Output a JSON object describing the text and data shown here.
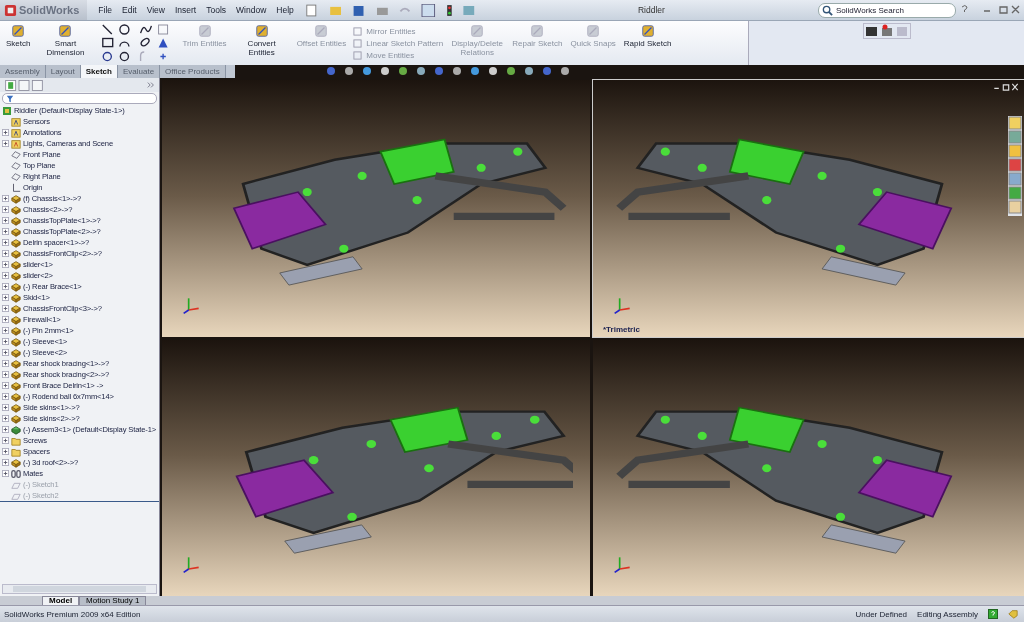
{
  "window": {
    "logo": "SolidWorks",
    "title": "Riddler"
  },
  "menu": [
    "File",
    "Edit",
    "View",
    "Insert",
    "Tools",
    "Window",
    "Help"
  ],
  "search": {
    "placeholder": "SolidWorks Search"
  },
  "commands": [
    {
      "kind": "large",
      "label": "Sketch",
      "disabled": false
    },
    {
      "kind": "large",
      "label": "Smart Dimension",
      "disabled": false
    },
    {
      "kind": "tools"
    },
    {
      "kind": "large",
      "label": "Trim Entities",
      "disabled": true
    },
    {
      "kind": "large",
      "label": "Convert Entities",
      "disabled": false
    },
    {
      "kind": "large",
      "label": "Offset Entities",
      "disabled": true
    },
    {
      "kind": "list",
      "items": [
        {
          "label": "Mirror Entities",
          "disabled": true
        },
        {
          "label": "Linear Sketch Pattern",
          "disabled": true
        },
        {
          "label": "Move Entities",
          "disabled": true
        }
      ]
    },
    {
      "kind": "large",
      "label": "Display/Delete Relations",
      "disabled": true
    },
    {
      "kind": "large",
      "label": "Repair Sketch",
      "disabled": true
    },
    {
      "kind": "large",
      "label": "Quick Snaps",
      "disabled": true
    },
    {
      "kind": "large",
      "label": "Rapid Sketch",
      "disabled": false
    }
  ],
  "tabs": [
    {
      "label": "Assembly",
      "selected": false
    },
    {
      "label": "Layout",
      "selected": false
    },
    {
      "label": "Sketch",
      "selected": true
    },
    {
      "label": "Evaluate",
      "selected": false
    },
    {
      "label": "Office Products",
      "selected": false
    }
  ],
  "tree": {
    "label": "Riddler  (Default<Display State-1>)",
    "children": [
      {
        "kind": "sensor",
        "label": "Sensors",
        "collapsed": false,
        "disabled": false
      },
      {
        "kind": "annotation",
        "label": "Annotations",
        "collapsed": true,
        "disabled": false
      },
      {
        "kind": "lights",
        "label": "Lights, Cameras and Scene",
        "collapsed": true,
        "disabled": false
      },
      {
        "kind": "plane",
        "label": "Front Plane",
        "collapsed": false,
        "disabled": false
      },
      {
        "kind": "plane",
        "label": "Top Plane",
        "collapsed": false,
        "disabled": false
      },
      {
        "kind": "plane",
        "label": "Right Plane",
        "collapsed": false,
        "disabled": false
      },
      {
        "kind": "origin",
        "label": "Origin",
        "collapsed": false,
        "disabled": false
      },
      {
        "kind": "part",
        "label": "(f) Chassis<1>->?",
        "collapsed": true,
        "disabled": false
      },
      {
        "kind": "part",
        "label": "Chassis<2>->?",
        "collapsed": true,
        "disabled": false
      },
      {
        "kind": "part",
        "label": "ChassisTopPlate<1>->?",
        "collapsed": true,
        "disabled": false
      },
      {
        "kind": "part",
        "label": "ChassisTopPlate<2>->?",
        "collapsed": true,
        "disabled": false
      },
      {
        "kind": "part",
        "label": "Delrin spacer<1>->?",
        "collapsed": true,
        "disabled": false
      },
      {
        "kind": "part",
        "label": "ChassisFrontClip<2>->?",
        "collapsed": true,
        "disabled": false
      },
      {
        "kind": "part",
        "label": "slider<1>",
        "collapsed": true,
        "disabled": false
      },
      {
        "kind": "part",
        "label": "slider<2>",
        "collapsed": true,
        "disabled": false
      },
      {
        "kind": "part",
        "label": "(-) Rear Brace<1>",
        "collapsed": true,
        "disabled": false
      },
      {
        "kind": "part",
        "label": "Skid<1>",
        "collapsed": true,
        "disabled": false
      },
      {
        "kind": "part",
        "label": "ChassisFrontClip<3>->?",
        "collapsed": true,
        "disabled": false
      },
      {
        "kind": "part",
        "label": "Firewall<1>",
        "collapsed": true,
        "disabled": false
      },
      {
        "kind": "part",
        "label": "(-) Pin 2mm<1>",
        "collapsed": true,
        "disabled": false
      },
      {
        "kind": "part",
        "label": "(-) Sleeve<1>",
        "collapsed": true,
        "disabled": false
      },
      {
        "kind": "part",
        "label": "(-) Sleeve<2>",
        "collapsed": true,
        "disabled": false
      },
      {
        "kind": "part",
        "label": "Rear shock bracing<1>->?",
        "collapsed": true,
        "disabled": false
      },
      {
        "kind": "part",
        "label": "Rear shock bracing<2>->?",
        "collapsed": true,
        "disabled": false
      },
      {
        "kind": "part",
        "label": "Front Brace Delrin<1> ->",
        "collapsed": true,
        "disabled": false
      },
      {
        "kind": "part",
        "label": "(-) Rodend ball 6x7mm<14>",
        "collapsed": true,
        "disabled": false
      },
      {
        "kind": "part",
        "label": "Side skins<1>->?",
        "collapsed": true,
        "disabled": false
      },
      {
        "kind": "part",
        "label": "Side skins<2>->?",
        "collapsed": true,
        "disabled": false
      },
      {
        "kind": "assembly",
        "label": "(-) Assem3<1> (Default<Display State-1>",
        "collapsed": true,
        "disabled": false
      },
      {
        "kind": "folder",
        "label": "Screws",
        "collapsed": true,
        "disabled": false
      },
      {
        "kind": "folder",
        "label": "Spacers",
        "collapsed": true,
        "disabled": false
      },
      {
        "kind": "part",
        "label": "(-) 3d roof<2>->?",
        "collapsed": true,
        "disabled": false
      },
      {
        "kind": "mates",
        "label": "Mates",
        "collapsed": true,
        "disabled": false
      },
      {
        "kind": "sketch",
        "label": "(-) Sketch1",
        "collapsed": false,
        "disabled": true
      },
      {
        "kind": "sketch",
        "label": "(-) Sketch2",
        "collapsed": false,
        "disabled": true
      }
    ]
  },
  "viewports": [
    {
      "active": false
    },
    {
      "view_label": "*Trimetric",
      "active": true
    },
    {
      "active": false
    },
    {
      "active": false
    }
  ],
  "bottom_tabs": [
    {
      "label": "Model",
      "selected": true
    },
    {
      "label": "Motion Study 1",
      "selected": false
    }
  ],
  "status_bar": {
    "edition": "SolidWorks Premium 2009 x64 Edition",
    "sketch_state": "Under Defined",
    "mode": "Editing Assembly"
  }
}
